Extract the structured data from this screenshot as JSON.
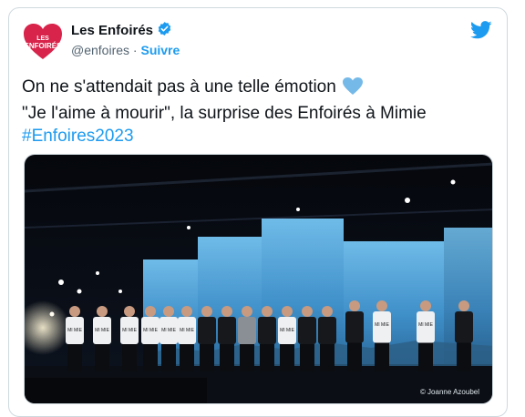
{
  "tweet": {
    "display_name": "Les Enfoirés",
    "handle": "@enfoires",
    "separator": " · ",
    "follow_label": "Suivre",
    "avatar_text": "LES ENFOIRÉS",
    "line1": "On ne s'attendait pas à une telle émotion",
    "line2": "\"Je l'aime à mourir\", la surprise des Enfoirés à Mimie",
    "hashtag": "#Enfoires2023",
    "photo_credit": "© Joanne Azoubel",
    "shirt_text": "MI MIE"
  },
  "colors": {
    "brand_red": "#d8234a",
    "link_blue": "#1d9bf0",
    "verified_blue": "#1d9bf0",
    "heart_blue": "#74b9e8",
    "stage_blue": "#4fa3d8"
  },
  "icons": {
    "verified": "verified-badge-icon",
    "bird": "twitter-bird-icon",
    "heart": "blue-heart-emoji-icon"
  }
}
